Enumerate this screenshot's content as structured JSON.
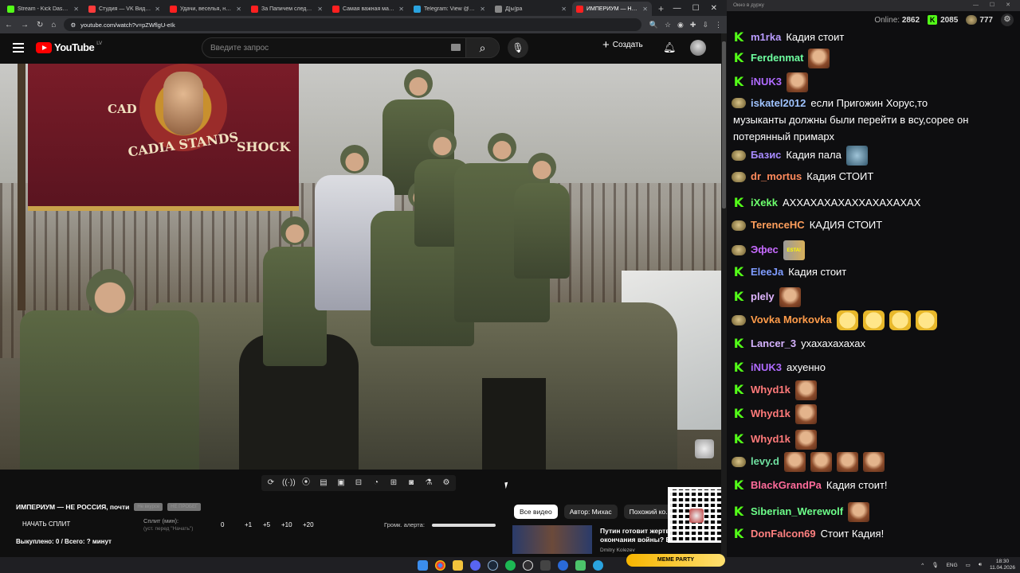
{
  "browser": {
    "tabs": [
      {
        "label": "Stream - Kick Dashboard",
        "color": "#53fc18"
      },
      {
        "label": "Студия — VK Видео Live",
        "color": "#ff3b3b"
      },
      {
        "label": "Удачи, веселья, не сдо...",
        "color": "#ff2020"
      },
      {
        "label": "За Папичем следят в ...",
        "color": "#ff2020"
      },
      {
        "label": "Самая важная машина ...",
        "color": "#ff2020"
      },
      {
        "label": "Telegram: View @grokS",
        "color": "#2aa3df"
      },
      {
        "label": "Д[ы]ра",
        "color": "#888888"
      },
      {
        "label": "ИМПЕРИУМ — НЕ ...",
        "color": "#ff2020",
        "active": true
      }
    ],
    "url": "youtube.com/watch?v=pZWflgU-eIk"
  },
  "youtube": {
    "logo": "YouTube",
    "region": "LV",
    "search_placeholder": "Введите запрос",
    "create_label": "Создать"
  },
  "video": {
    "banner_top": "CAD",
    "banner_shock": "SHOCK",
    "banner_main": "CADIA STANDS"
  },
  "below": {
    "title": "ИМПЕРИУМ — НЕ РОССИЯ, почти",
    "pill1": "Не вкурсе",
    "pill2": "НЕ ПРОБЕГ",
    "split_button": "НАЧАТЬ СПЛИТ",
    "split_label": "Сплит (мин):",
    "split_sub": "(уст. перед \"Начать\")",
    "split_values": [
      "0",
      "+1",
      "+5",
      "+10",
      "+20"
    ],
    "alert_label": "Громк. алерта:",
    "bought": "Выкуплено: 0 / Всего: ? минут",
    "chips": [
      "Все видео",
      "Автор: Михас",
      "Похожий ко..."
    ],
    "rec_title": "Путин готовит жертв окончания войны? В",
    "rec_author": "Dmitry Kolezev",
    "meme_party": "MEME PARTY"
  },
  "chat_window": {
    "title": "Окно в дурку",
    "online_label": "Online:",
    "online": "2862",
    "kick_count": "2085",
    "sub_count": "777"
  },
  "chat": [
    {
      "badge": "k",
      "user": "m1rka",
      "color": "#b99cff",
      "text": "Кадия стоит",
      "emotes": []
    },
    {
      "badge": "k",
      "user": "Ferdenmat",
      "color": "#6effa0",
      "text": "",
      "emotes": [
        "face"
      ]
    },
    {
      "badge": "k",
      "user": "iNUK3",
      "color": "#b06bff",
      "text": "",
      "emotes": [
        "face"
      ]
    },
    {
      "badge": "sub",
      "user": "iskatel2012",
      "color": "#9fc3ff",
      "text": "если Пригожин Хорус,то",
      "more": "музыканты должны были перейти в всу,сорее он потерянный примарх",
      "emotes": []
    },
    {
      "badge": "sub",
      "user": "Базис",
      "color": "#a88bff",
      "text": "Кадия пала",
      "emotes": [
        "bird"
      ]
    },
    {
      "badge": "sub",
      "user": "dr_mortus",
      "color": "#ff8a5c",
      "text": "Кадия СТОИТ",
      "emotes": []
    },
    {
      "badge": "k",
      "user": "iXekk",
      "color": "#6dff6d",
      "text": "АХХАХАХАХАХХАХАХАХАХ",
      "emotes": []
    },
    {
      "badge": "sub",
      "user": "TerenceHC",
      "color": "#ff9f5c",
      "text": "КАДИЯ СТОИТ",
      "emotes": []
    },
    {
      "badge": "sub",
      "user": "Эфес",
      "color": "#c76bff",
      "text": "",
      "emotes": [
        "esta"
      ]
    },
    {
      "badge": "k",
      "user": "EleeJa",
      "color": "#7f9cff",
      "text": "Кадия стоит",
      "emotes": []
    },
    {
      "badge": "k",
      "user": "plely",
      "color": "#e0b5ff",
      "text": "",
      "emotes": [
        "face"
      ]
    },
    {
      "badge": "sub",
      "user": "Vovka Morkovka",
      "color": "#ff9c4a",
      "text": "",
      "emotes": [
        "smile",
        "smile",
        "smile",
        "smile"
      ]
    },
    {
      "badge": "k",
      "user": "Lancer_3",
      "color": "#d6b3ff",
      "text": "ухахахахахах",
      "emotes": []
    },
    {
      "badge": "k",
      "user": "iNUK3",
      "color": "#b06bff",
      "text": "ахуенно",
      "emotes": []
    },
    {
      "badge": "k",
      "user": "Whyd1k",
      "color": "#ff7a7a",
      "text": "",
      "emotes": [
        "face"
      ]
    },
    {
      "badge": "k",
      "user": "Whyd1k",
      "color": "#ff7a7a",
      "text": "",
      "emotes": [
        "face"
      ]
    },
    {
      "badge": "k",
      "user": "Whyd1k",
      "color": "#ff7a7a",
      "text": "",
      "emotes": [
        "face"
      ]
    },
    {
      "badge": "sub",
      "user": "levy.d",
      "color": "#6fe0a0",
      "text": "",
      "emotes": [
        "face",
        "face",
        "face",
        "face"
      ]
    },
    {
      "badge": "k",
      "user": "BlackGrandPa",
      "color": "#ff6b9a",
      "text": "Кадия стоит!",
      "emotes": []
    },
    {
      "badge": "k",
      "user": "Siberian_Werewolf",
      "color": "#6dff8a",
      "text": "",
      "emotes": [
        "face"
      ]
    },
    {
      "badge": "k",
      "user": "DonFalcon69",
      "color": "#ff8080",
      "text": "Стоит Кадия!",
      "emotes": []
    }
  ],
  "taskbar": {
    "lang": "ENG",
    "time": "18:30",
    "date": "11.04.2026"
  }
}
